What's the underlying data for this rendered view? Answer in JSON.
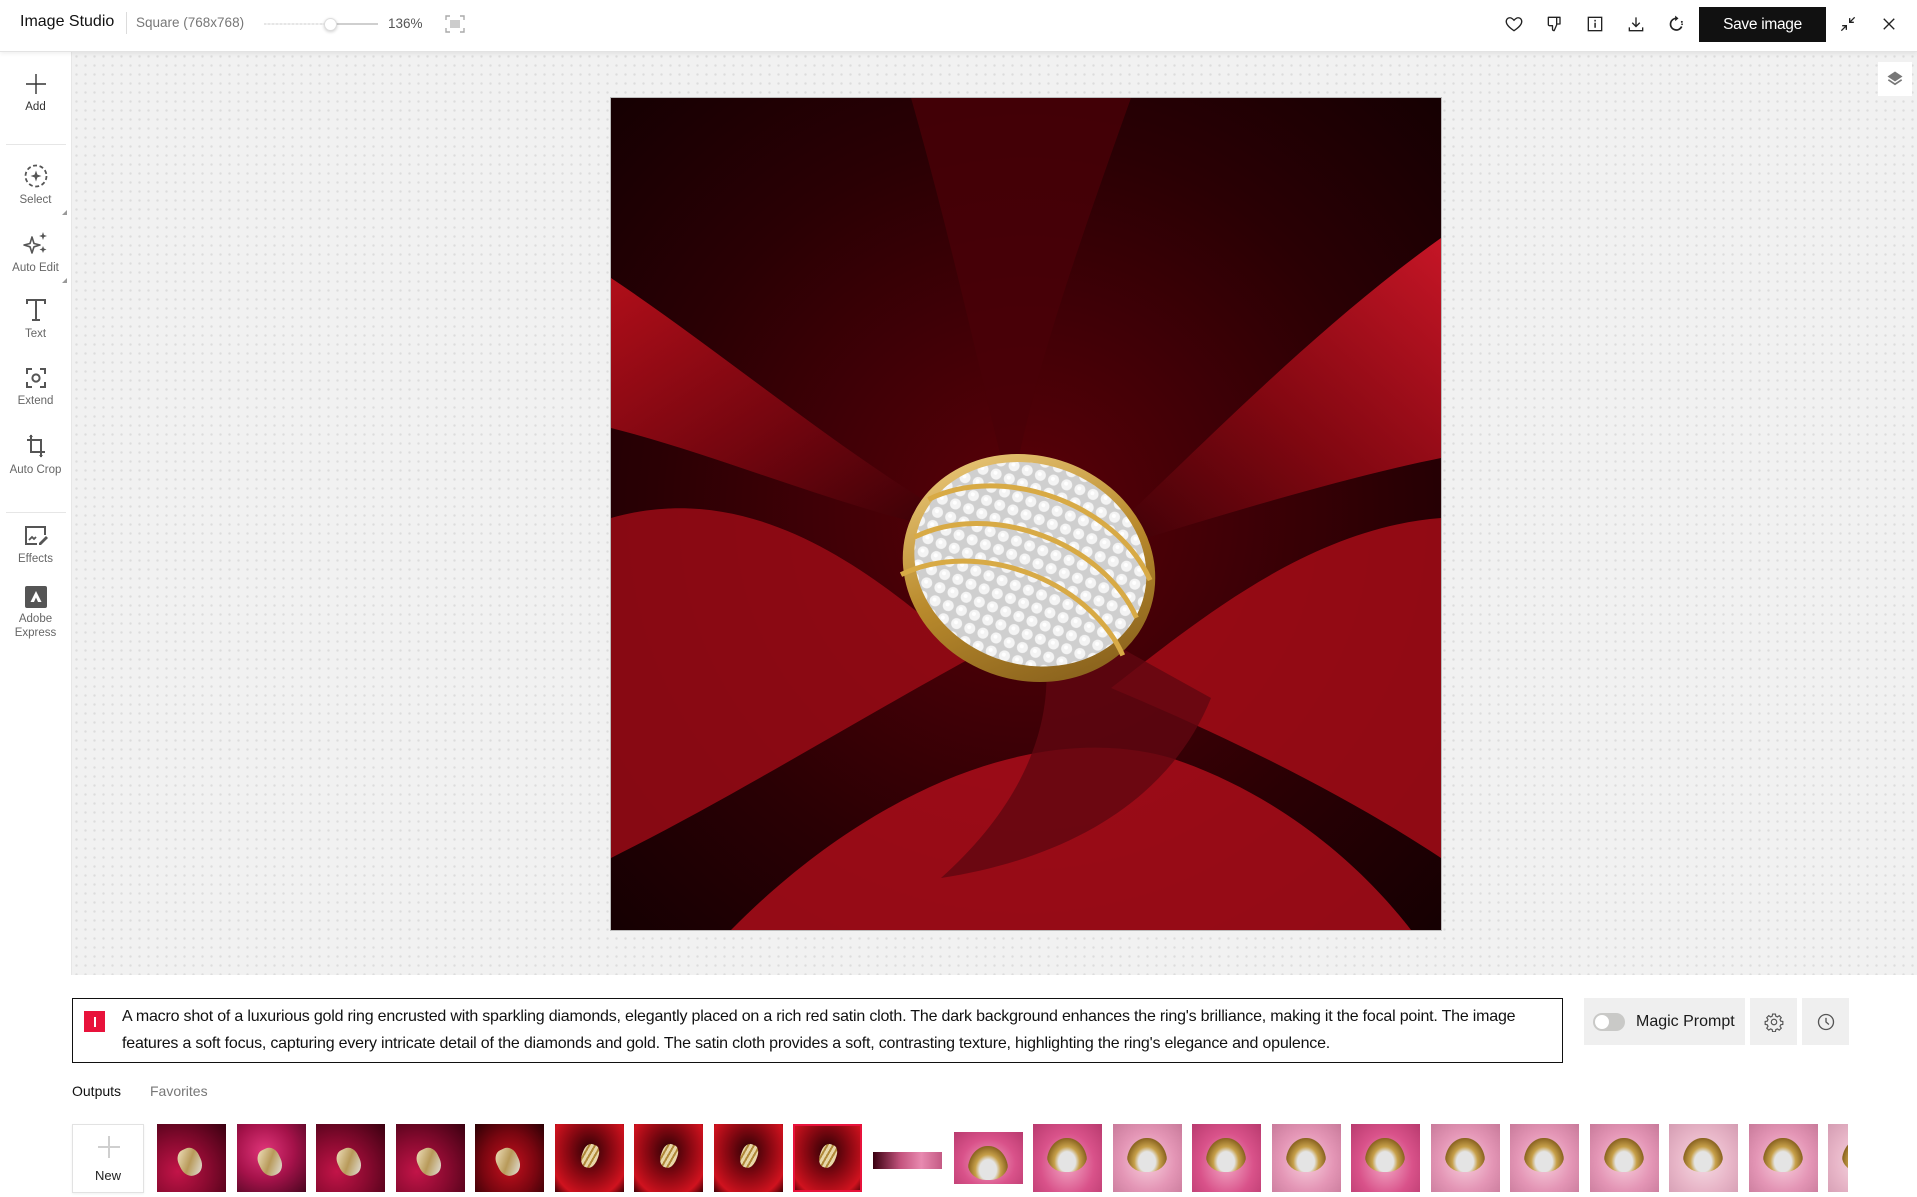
{
  "header": {
    "app_title": "Image Studio",
    "canvas_size": "Square (768x768)",
    "zoom_level": "136%",
    "zoom_slider_fraction": 0.58,
    "icons": {
      "fit": "fit-to-screen-icon",
      "favorite": "heart-icon",
      "dislike": "thumbs-down-icon",
      "info": "info-icon",
      "download": "download-icon",
      "regenerate": "refresh-icon",
      "minimize": "minimize-icon",
      "close": "close-icon"
    },
    "save_label": "Save image"
  },
  "sidebar": {
    "items": [
      {
        "id": "add",
        "label": "Add",
        "icon": "plus-icon"
      },
      {
        "id": "select",
        "label": "Select",
        "icon": "select-icon",
        "has_submenu": true
      },
      {
        "id": "auto-edit",
        "label": "Auto Edit",
        "icon": "sparkle-icon",
        "has_submenu": true
      },
      {
        "id": "text",
        "label": "Text",
        "icon": "text-icon"
      },
      {
        "id": "extend",
        "label": "Extend",
        "icon": "extend-icon"
      },
      {
        "id": "auto-crop",
        "label": "Auto Crop",
        "icon": "crop-icon"
      },
      {
        "id": "effects",
        "label": "Effects",
        "icon": "effects-icon"
      },
      {
        "id": "adobe-express",
        "label": "Adobe\nExpress",
        "label_lines": [
          "Adobe",
          "Express"
        ],
        "icon": "adobe-express-icon"
      }
    ]
  },
  "canvas": {
    "layers_icon": "layers-icon",
    "image_description": "Gold ring with diamonds on red satin cloth"
  },
  "prompt": {
    "text": "A macro shot of a luxurious gold ring encrusted with sparkling diamonds, elegantly placed on a rich red satin cloth. The dark background enhances the ring's brilliance, making it the focal point. The image features a soft focus, capturing every intricate detail of the diamonds and gold. The satin cloth provides a soft, contrasting texture, highlighting the ring's elegance and opulence.",
    "badge_color": "#e8123b",
    "magic_prompt_label": "Magic Prompt",
    "magic_prompt_enabled": false,
    "settings_icon": "gear-icon",
    "history_icon": "clock-icon"
  },
  "outputs": {
    "tabs": [
      {
        "label": "Outputs",
        "active": true
      },
      {
        "label": "Favorites",
        "active": false
      }
    ],
    "new_label": "New",
    "thumbnails": [
      {
        "theme": "magenta-satin",
        "ring": "pear-diamond",
        "selected": false
      },
      {
        "theme": "pink-satin",
        "ring": "pear-diamond",
        "selected": false
      },
      {
        "theme": "magenta-satin",
        "ring": "pear-diamond",
        "selected": false
      },
      {
        "theme": "magenta-satin",
        "ring": "pear-diamond",
        "selected": false
      },
      {
        "theme": "red-satin",
        "ring": "pear-diamond",
        "selected": false
      },
      {
        "theme": "dark-red-satin",
        "ring": "band",
        "selected": false
      },
      {
        "theme": "dark-red-satin",
        "ring": "band",
        "selected": false
      },
      {
        "theme": "dark-red-satin",
        "ring": "band",
        "selected": false
      },
      {
        "theme": "dark-red-satin",
        "ring": "band",
        "selected": true
      },
      {
        "theme": "wide-pink",
        "ring": "small",
        "selected": false
      },
      {
        "theme": "pink-rose",
        "ring": "gold-band",
        "selected": false
      },
      {
        "theme": "pink-rose",
        "ring": "gold-band",
        "selected": false
      },
      {
        "theme": "light-pink-rose",
        "ring": "gold-band",
        "selected": false
      },
      {
        "theme": "pink-rose",
        "ring": "gold-band",
        "selected": false
      },
      {
        "theme": "light-pink-rose",
        "ring": "gold-band",
        "selected": false
      },
      {
        "theme": "pink-rose",
        "ring": "gold-band",
        "selected": false
      },
      {
        "theme": "light-pink-rose",
        "ring": "gold-band",
        "selected": false
      },
      {
        "theme": "light-pink-rose",
        "ring": "gold-band",
        "selected": false
      },
      {
        "theme": "light-pink-rose",
        "ring": "gold-band",
        "selected": false
      },
      {
        "theme": "pale-pink-rose",
        "ring": "gold-band",
        "selected": false
      },
      {
        "theme": "light-pink-rose",
        "ring": "gold-band",
        "selected": false
      },
      {
        "theme": "pale-pink-rose",
        "ring": "gold-band",
        "selected": false
      }
    ]
  },
  "colors": {
    "accent": "#e8123b",
    "save_button_bg": "#111111"
  }
}
